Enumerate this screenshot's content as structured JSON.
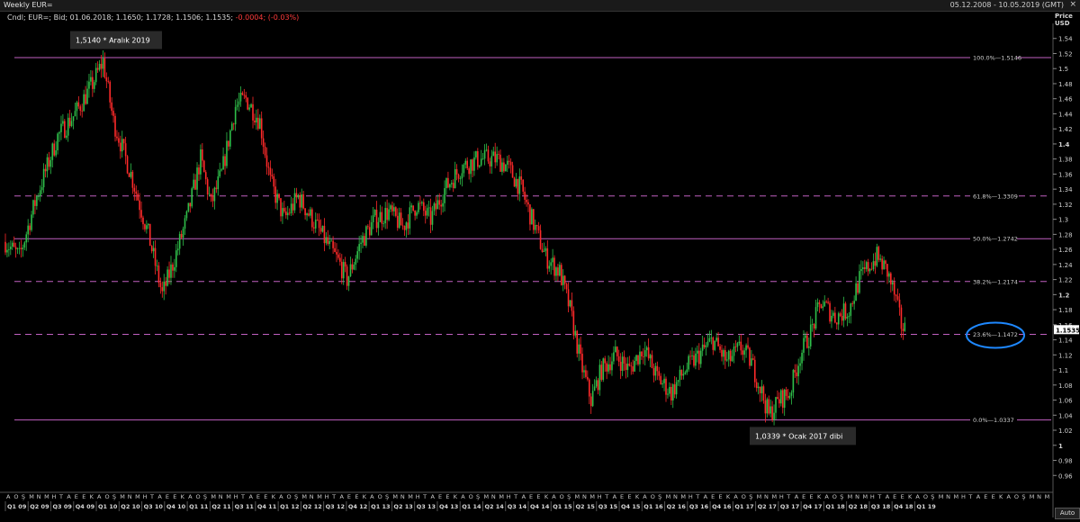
{
  "window": {
    "title": "Weekly EUR=",
    "date_range": "05.12.2008 - 10.05.2019 (GMT)",
    "close_glyph": "×"
  },
  "infobar": {
    "text": "Cndl; EUR=; Bid; 01.06.2018; 1.1650; 1.1728; 1.1506; 1.1535;",
    "change": "-0.0004; (-0.03%)"
  },
  "axis_header": {
    "line1": "Price",
    "line2": "USD"
  },
  "auto_button": "Auto",
  "colors": {
    "background": "#000000",
    "up_candle": "#2fbf4a",
    "down_candle": "#ff2a2a",
    "fib_line": "#c060c0",
    "ellipse": "#1e88ff"
  },
  "icons": [
    "close-icon"
  ],
  "chart_data": {
    "type": "candlestick",
    "instrument": "EUR=",
    "period": "Weekly",
    "y_axis": {
      "ylim": [
        0.94,
        1.56
      ],
      "ticks": [
        0.96,
        0.98,
        1.0,
        1.02,
        1.04,
        1.06,
        1.08,
        1.1,
        1.12,
        1.14,
        1.16,
        1.18,
        1.2,
        1.22,
        1.24,
        1.26,
        1.28,
        1.3,
        1.32,
        1.34,
        1.36,
        1.38,
        1.4,
        1.42,
        1.44,
        1.46,
        1.48,
        1.5,
        1.52,
        1.54
      ],
      "tick_labels": [
        "0.96",
        "0.98",
        "1",
        "1.02",
        "1.04",
        "1.06",
        "1.08",
        "1.1",
        "1.12",
        "1.14",
        "1.16",
        "1.18",
        "1.2",
        "1.22",
        "1.24",
        "1.26",
        "1.28",
        "1.3",
        "1.32",
        "1.34",
        "1.36",
        "1.38",
        "1.4",
        "1.42",
        "1.44",
        "1.46",
        "1.48",
        "1.5",
        "1.52",
        "1.54"
      ],
      "bold_ticks": [
        1.0,
        1.2,
        1.4
      ],
      "last_price": "1.1535"
    },
    "x_axis": {
      "month_letters": [
        "A",
        "O",
        "Ş",
        "M",
        "N",
        "M",
        "H",
        "T",
        "A",
        "E",
        "E",
        "K",
        "A",
        "O",
        "Ş",
        "M",
        "N",
        "M",
        "H",
        "T",
        "A",
        "E",
        "E",
        "K",
        "A",
        "O",
        "Ş",
        "M",
        "N",
        "M",
        "H",
        "T",
        "A",
        "E",
        "E",
        "K",
        "A",
        "O",
        "Ş",
        "M",
        "N",
        "M",
        "H",
        "T",
        "A",
        "E",
        "E",
        "K",
        "A",
        "O",
        "Ş",
        "M",
        "N",
        "M",
        "H",
        "T",
        "A",
        "E",
        "E",
        "K",
        "A",
        "O",
        "Ş",
        "M",
        "N",
        "M",
        "H",
        "T",
        "A",
        "E",
        "E",
        "K",
        "A",
        "O",
        "Ş",
        "M",
        "N",
        "M",
        "H",
        "T",
        "A",
        "E",
        "E",
        "K",
        "A",
        "O",
        "Ş",
        "M",
        "N",
        "M",
        "H",
        "T",
        "A",
        "E",
        "E",
        "K",
        "A",
        "O",
        "Ş",
        "M",
        "N",
        "M",
        "H",
        "T",
        "A",
        "E",
        "E",
        "K",
        "A",
        "O",
        "Ş",
        "M",
        "N",
        "M",
        "H",
        "T",
        "A",
        "E",
        "E",
        "K",
        "A",
        "O",
        "Ş",
        "M",
        "N",
        "M",
        "H",
        "T",
        "A",
        "E",
        "E",
        "K",
        "A",
        "O",
        "Ş",
        "M",
        "N",
        "M"
      ],
      "quarters": [
        "Q1 09",
        "Q2 09",
        "Q3 09",
        "Q4 09",
        "Q1 10",
        "Q2 10",
        "Q3 10",
        "Q4 10",
        "Q1 11",
        "Q2 11",
        "Q3 11",
        "Q4 11",
        "Q1 12",
        "Q2 12",
        "Q3 12",
        "Q4 12",
        "Q1 13",
        "Q2 13",
        "Q3 13",
        "Q4 13",
        "Q1 14",
        "Q2 14",
        "Q3 14",
        "Q4 14",
        "Q1 15",
        "Q2 15",
        "Q3 15",
        "Q4 15",
        "Q1 16",
        "Q2 16",
        "Q3 16",
        "Q4 16",
        "Q1 17",
        "Q2 17",
        "Q3 17",
        "Q4 17",
        "Q1 18",
        "Q2 18",
        "Q3 18",
        "Q4 18",
        "Q1 19"
      ]
    },
    "fib_levels": [
      {
        "pct": "100.0%",
        "value": 1.5146,
        "label": "1.5146",
        "style": "solid"
      },
      {
        "pct": "61.8%",
        "value": 1.3309,
        "label": "1.3309",
        "style": "dashed"
      },
      {
        "pct": "50.0%",
        "value": 1.2742,
        "label": "1.2742",
        "style": "solid"
      },
      {
        "pct": "38.2%",
        "value": 1.2174,
        "label": "1.2174",
        "style": "dashed"
      },
      {
        "pct": "23.6%",
        "value": 1.1472,
        "label": "1.1472",
        "style": "dashed"
      },
      {
        "pct": "0.0%",
        "value": 1.0337,
        "label": "1.0337",
        "style": "solid"
      }
    ],
    "annotations": [
      {
        "text": "1,5140  * Aralık 2019",
        "value": 1.514
      },
      {
        "text": "1,0339 * Ocak 2017 dibi",
        "value": 1.0339
      }
    ],
    "highlight": {
      "label": "23.6% - 1.1472",
      "value": 1.1472
    },
    "price_path": [
      {
        "week": 0,
        "price": 1.27
      },
      {
        "week": 8,
        "price": 1.25
      },
      {
        "week": 18,
        "price": 1.33
      },
      {
        "week": 30,
        "price": 1.41
      },
      {
        "week": 40,
        "price": 1.44
      },
      {
        "week": 50,
        "price": 1.48
      },
      {
        "week": 56,
        "price": 1.51
      },
      {
        "week": 62,
        "price": 1.43
      },
      {
        "week": 72,
        "price": 1.36
      },
      {
        "week": 82,
        "price": 1.28
      },
      {
        "week": 90,
        "price": 1.2
      },
      {
        "week": 96,
        "price": 1.24
      },
      {
        "week": 104,
        "price": 1.3
      },
      {
        "week": 112,
        "price": 1.38
      },
      {
        "week": 118,
        "price": 1.32
      },
      {
        "week": 124,
        "price": 1.36
      },
      {
        "week": 132,
        "price": 1.45
      },
      {
        "week": 138,
        "price": 1.46
      },
      {
        "week": 146,
        "price": 1.43
      },
      {
        "week": 152,
        "price": 1.35
      },
      {
        "week": 160,
        "price": 1.3
      },
      {
        "week": 168,
        "price": 1.33
      },
      {
        "week": 176,
        "price": 1.3
      },
      {
        "week": 184,
        "price": 1.27
      },
      {
        "week": 192,
        "price": 1.24
      },
      {
        "week": 196,
        "price": 1.22
      },
      {
        "week": 204,
        "price": 1.27
      },
      {
        "week": 212,
        "price": 1.3
      },
      {
        "week": 220,
        "price": 1.31
      },
      {
        "week": 228,
        "price": 1.29
      },
      {
        "week": 236,
        "price": 1.32
      },
      {
        "week": 244,
        "price": 1.3
      },
      {
        "week": 252,
        "price": 1.34
      },
      {
        "week": 262,
        "price": 1.37
      },
      {
        "week": 272,
        "price": 1.38
      },
      {
        "week": 282,
        "price": 1.38
      },
      {
        "week": 288,
        "price": 1.37
      },
      {
        "week": 296,
        "price": 1.34
      },
      {
        "week": 302,
        "price": 1.3
      },
      {
        "week": 310,
        "price": 1.25
      },
      {
        "week": 318,
        "price": 1.23
      },
      {
        "week": 324,
        "price": 1.18
      },
      {
        "week": 330,
        "price": 1.11
      },
      {
        "week": 336,
        "price": 1.06
      },
      {
        "week": 342,
        "price": 1.1
      },
      {
        "week": 350,
        "price": 1.12
      },
      {
        "week": 358,
        "price": 1.1
      },
      {
        "week": 366,
        "price": 1.13
      },
      {
        "week": 374,
        "price": 1.09
      },
      {
        "week": 382,
        "price": 1.07
      },
      {
        "week": 390,
        "price": 1.1
      },
      {
        "week": 398,
        "price": 1.12
      },
      {
        "week": 406,
        "price": 1.14
      },
      {
        "week": 414,
        "price": 1.11
      },
      {
        "week": 422,
        "price": 1.13
      },
      {
        "week": 428,
        "price": 1.11
      },
      {
        "week": 434,
        "price": 1.07
      },
      {
        "week": 438,
        "price": 1.04
      },
      {
        "week": 444,
        "price": 1.06
      },
      {
        "week": 450,
        "price": 1.07
      },
      {
        "week": 456,
        "price": 1.12
      },
      {
        "week": 462,
        "price": 1.15
      },
      {
        "week": 468,
        "price": 1.19
      },
      {
        "week": 476,
        "price": 1.17
      },
      {
        "week": 484,
        "price": 1.18
      },
      {
        "week": 490,
        "price": 1.22
      },
      {
        "week": 496,
        "price": 1.24
      },
      {
        "week": 500,
        "price": 1.25
      },
      {
        "week": 506,
        "price": 1.23
      },
      {
        "week": 510,
        "price": 1.2
      },
      {
        "week": 514,
        "price": 1.16
      },
      {
        "week": 516,
        "price": 1.1535
      }
    ]
  }
}
